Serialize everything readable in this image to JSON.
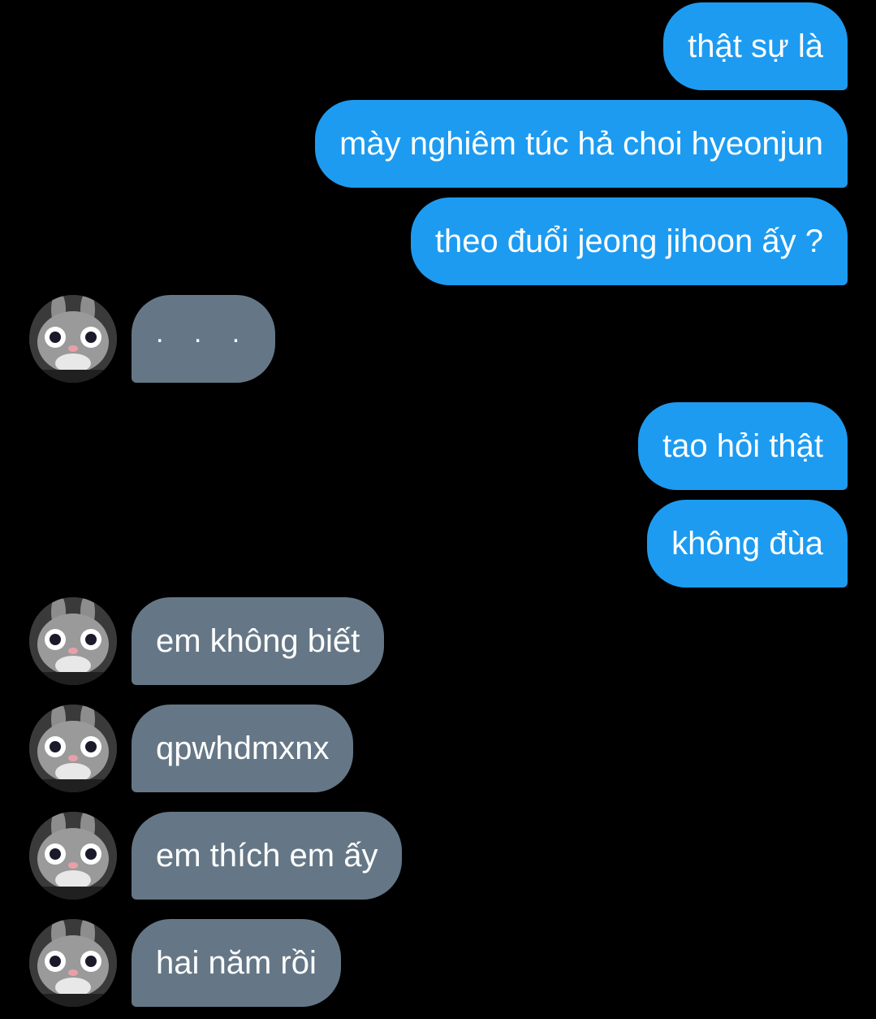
{
  "conversation": {
    "messages": [
      {
        "side": "sent",
        "text": "thật sự là"
      },
      {
        "side": "sent",
        "text": "mày nghiêm túc hả choi hyeonjun"
      },
      {
        "side": "sent",
        "text": "theo đuổi jeong jihoon ấy ?"
      },
      {
        "side": "received",
        "text": ". . ."
      },
      {
        "side": "sent",
        "text": "tao hỏi thật"
      },
      {
        "side": "sent",
        "text": "không đùa"
      },
      {
        "side": "received",
        "text": "em không biết"
      },
      {
        "side": "received",
        "text": "qpwhdmxnx"
      },
      {
        "side": "received",
        "text": "em thích em ấy"
      },
      {
        "side": "received",
        "text": "hai năm rồi"
      }
    ]
  },
  "colors": {
    "background": "#000000",
    "sent_bubble": "#1d9bf0",
    "received_bubble": "#657786",
    "text": "#ffffff"
  },
  "icons": {
    "avatar": "bunny-mascot-avatar-icon"
  }
}
